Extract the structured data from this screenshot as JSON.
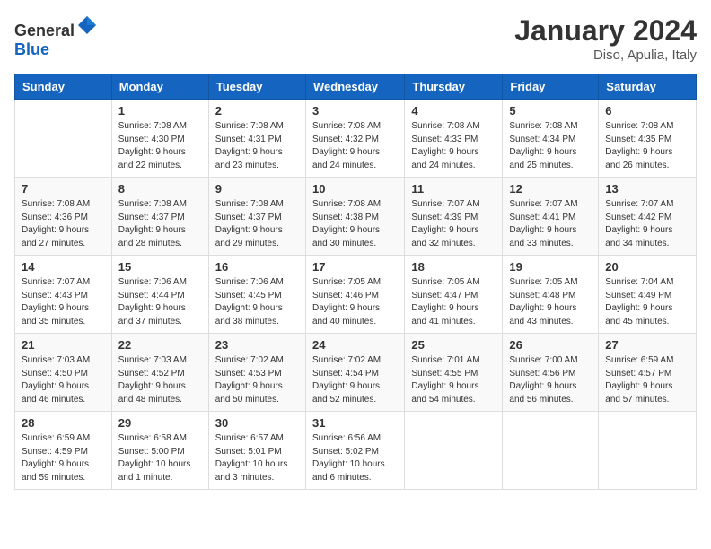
{
  "header": {
    "logo_general": "General",
    "logo_blue": "Blue",
    "month_title": "January 2024",
    "location": "Diso, Apulia, Italy"
  },
  "days_of_week": [
    "Sunday",
    "Monday",
    "Tuesday",
    "Wednesday",
    "Thursday",
    "Friday",
    "Saturday"
  ],
  "weeks": [
    [
      {
        "day": "",
        "info": ""
      },
      {
        "day": "1",
        "info": "Sunrise: 7:08 AM\nSunset: 4:30 PM\nDaylight: 9 hours\nand 22 minutes."
      },
      {
        "day": "2",
        "info": "Sunrise: 7:08 AM\nSunset: 4:31 PM\nDaylight: 9 hours\nand 23 minutes."
      },
      {
        "day": "3",
        "info": "Sunrise: 7:08 AM\nSunset: 4:32 PM\nDaylight: 9 hours\nand 24 minutes."
      },
      {
        "day": "4",
        "info": "Sunrise: 7:08 AM\nSunset: 4:33 PM\nDaylight: 9 hours\nand 24 minutes."
      },
      {
        "day": "5",
        "info": "Sunrise: 7:08 AM\nSunset: 4:34 PM\nDaylight: 9 hours\nand 25 minutes."
      },
      {
        "day": "6",
        "info": "Sunrise: 7:08 AM\nSunset: 4:35 PM\nDaylight: 9 hours\nand 26 minutes."
      }
    ],
    [
      {
        "day": "7",
        "info": "Sunrise: 7:08 AM\nSunset: 4:36 PM\nDaylight: 9 hours\nand 27 minutes."
      },
      {
        "day": "8",
        "info": "Sunrise: 7:08 AM\nSunset: 4:37 PM\nDaylight: 9 hours\nand 28 minutes."
      },
      {
        "day": "9",
        "info": "Sunrise: 7:08 AM\nSunset: 4:37 PM\nDaylight: 9 hours\nand 29 minutes."
      },
      {
        "day": "10",
        "info": "Sunrise: 7:08 AM\nSunset: 4:38 PM\nDaylight: 9 hours\nand 30 minutes."
      },
      {
        "day": "11",
        "info": "Sunrise: 7:07 AM\nSunset: 4:39 PM\nDaylight: 9 hours\nand 32 minutes."
      },
      {
        "day": "12",
        "info": "Sunrise: 7:07 AM\nSunset: 4:41 PM\nDaylight: 9 hours\nand 33 minutes."
      },
      {
        "day": "13",
        "info": "Sunrise: 7:07 AM\nSunset: 4:42 PM\nDaylight: 9 hours\nand 34 minutes."
      }
    ],
    [
      {
        "day": "14",
        "info": "Sunrise: 7:07 AM\nSunset: 4:43 PM\nDaylight: 9 hours\nand 35 minutes."
      },
      {
        "day": "15",
        "info": "Sunrise: 7:06 AM\nSunset: 4:44 PM\nDaylight: 9 hours\nand 37 minutes."
      },
      {
        "day": "16",
        "info": "Sunrise: 7:06 AM\nSunset: 4:45 PM\nDaylight: 9 hours\nand 38 minutes."
      },
      {
        "day": "17",
        "info": "Sunrise: 7:05 AM\nSunset: 4:46 PM\nDaylight: 9 hours\nand 40 minutes."
      },
      {
        "day": "18",
        "info": "Sunrise: 7:05 AM\nSunset: 4:47 PM\nDaylight: 9 hours\nand 41 minutes."
      },
      {
        "day": "19",
        "info": "Sunrise: 7:05 AM\nSunset: 4:48 PM\nDaylight: 9 hours\nand 43 minutes."
      },
      {
        "day": "20",
        "info": "Sunrise: 7:04 AM\nSunset: 4:49 PM\nDaylight: 9 hours\nand 45 minutes."
      }
    ],
    [
      {
        "day": "21",
        "info": "Sunrise: 7:03 AM\nSunset: 4:50 PM\nDaylight: 9 hours\nand 46 minutes."
      },
      {
        "day": "22",
        "info": "Sunrise: 7:03 AM\nSunset: 4:52 PM\nDaylight: 9 hours\nand 48 minutes."
      },
      {
        "day": "23",
        "info": "Sunrise: 7:02 AM\nSunset: 4:53 PM\nDaylight: 9 hours\nand 50 minutes."
      },
      {
        "day": "24",
        "info": "Sunrise: 7:02 AM\nSunset: 4:54 PM\nDaylight: 9 hours\nand 52 minutes."
      },
      {
        "day": "25",
        "info": "Sunrise: 7:01 AM\nSunset: 4:55 PM\nDaylight: 9 hours\nand 54 minutes."
      },
      {
        "day": "26",
        "info": "Sunrise: 7:00 AM\nSunset: 4:56 PM\nDaylight: 9 hours\nand 56 minutes."
      },
      {
        "day": "27",
        "info": "Sunrise: 6:59 AM\nSunset: 4:57 PM\nDaylight: 9 hours\nand 57 minutes."
      }
    ],
    [
      {
        "day": "28",
        "info": "Sunrise: 6:59 AM\nSunset: 4:59 PM\nDaylight: 9 hours\nand 59 minutes."
      },
      {
        "day": "29",
        "info": "Sunrise: 6:58 AM\nSunset: 5:00 PM\nDaylight: 10 hours\nand 1 minute."
      },
      {
        "day": "30",
        "info": "Sunrise: 6:57 AM\nSunset: 5:01 PM\nDaylight: 10 hours\nand 3 minutes."
      },
      {
        "day": "31",
        "info": "Sunrise: 6:56 AM\nSunset: 5:02 PM\nDaylight: 10 hours\nand 6 minutes."
      },
      {
        "day": "",
        "info": ""
      },
      {
        "day": "",
        "info": ""
      },
      {
        "day": "",
        "info": ""
      }
    ]
  ]
}
